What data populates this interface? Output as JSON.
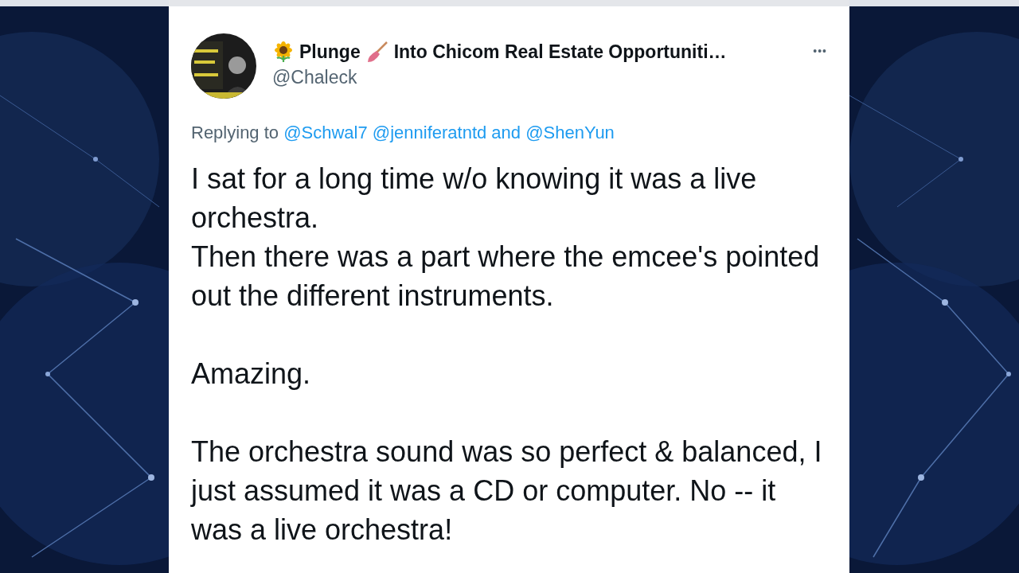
{
  "tweet": {
    "avatar": {
      "kind": "picture"
    },
    "display_name_start": "Plunge",
    "display_name_end": "Into Chicom Real Estate Opportuniti…",
    "handle": "@Chaleck",
    "more": "•••",
    "reply": {
      "prefix": "Replying to",
      "mentions": [
        "@Schwal7",
        "@jenniferatntd"
      ],
      "conjunction": "and",
      "last_mention": "@ShenYun"
    },
    "paragraphs": [
      [
        "I sat for a long time w/o knowing it was a live orchestra.",
        "Then there was a part where the emcee's pointed out the different instruments."
      ],
      [
        "Amazing."
      ],
      [
        "The orchestra sound was so perfect & balanced, I just assumed it was a CD or computer. No -- it was a live orchestra!"
      ]
    ]
  }
}
